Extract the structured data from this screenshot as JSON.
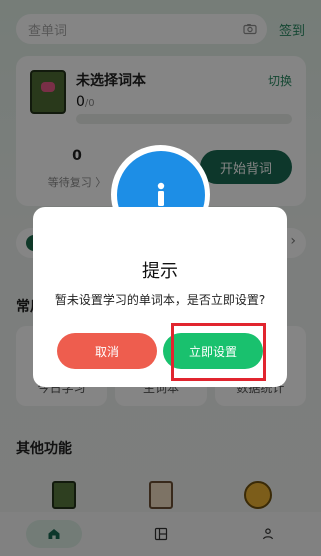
{
  "topbar": {
    "search_placeholder": "查单词",
    "signin_label": "签到"
  },
  "wordbook": {
    "title": "未选择词本",
    "switch_label": "切换",
    "progress_current": "0",
    "progress_total": "/0",
    "progress_fraction": 0,
    "review_count": "0",
    "review_label": "等待复习 〉",
    "start_button_label": "开始背词"
  },
  "sections": {
    "common_title": "常用",
    "other_title": "其他功能",
    "common_items": [
      "今日学习",
      "生词本",
      "数据统计"
    ]
  },
  "dialog": {
    "title": "提示",
    "message": "暂未设置学习的单词本，是否立即设置?",
    "cancel_label": "取消",
    "confirm_label": "立即设置",
    "icon_name": "info-icon"
  },
  "colors": {
    "brand_green": "#19c16e",
    "brand_dark_green": "#1a6a53",
    "danger": "#ee5d4e",
    "info_blue": "#1d8ee6",
    "highlight_red": "#e1252f"
  }
}
